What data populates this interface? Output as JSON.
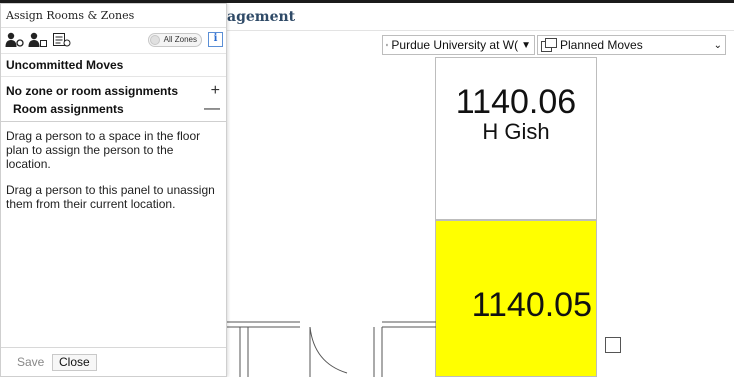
{
  "app": {
    "title_partial": "agement"
  },
  "panel": {
    "title": "Assign Rooms & Zones",
    "toggle_label": "All Zones",
    "info_label": "i",
    "section_title": "Uncommitted Moves",
    "rows": [
      {
        "label": "No zone or room assignments",
        "sign": "+"
      },
      {
        "label": "Room assignments",
        "sign": "—"
      }
    ],
    "help": [
      "Drag a person to a space in the floor plan to assign the person to the location.",
      "Drag a person to this panel to unassign them from their current location."
    ],
    "save_label": "Save",
    "close_label": "Close",
    "tool_icons": [
      "assign-person-zone-icon",
      "assign-person-room-icon",
      "list-assign-icon"
    ]
  },
  "toolbar": {
    "site_label": "Purdue University at W(",
    "moves_label": "Planned Moves",
    "site_icon": "floorplan-grid-icon",
    "moves_icon": "layers-icon"
  },
  "rooms": [
    {
      "number": "1140.06",
      "occupant": "H Gish",
      "color": "#ffffff"
    },
    {
      "number": "1140.05",
      "occupant": "",
      "color": "#ffff00"
    }
  ]
}
